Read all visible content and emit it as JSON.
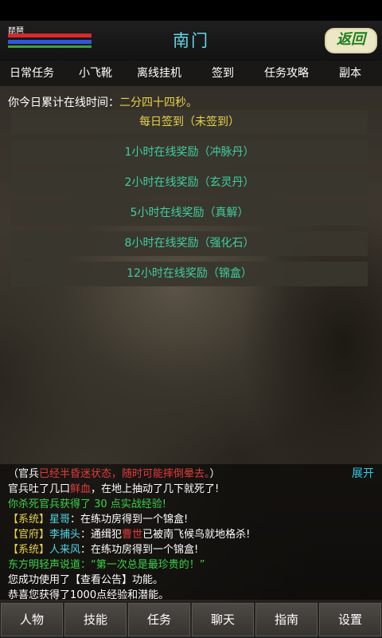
{
  "header": {
    "player_name": "琵琶",
    "title": "南门",
    "back_label": "返回"
  },
  "tabs": [
    "日常任务",
    "小飞靴",
    "离线挂机",
    "签到",
    "任务攻略",
    "副本"
  ],
  "online": {
    "label": "你今日累计在线时间：",
    "value": "二分四十四秒。"
  },
  "buttons": [
    "每日签到（未签到）",
    "1小时在线奖励（冲脉丹）",
    "2小时在线奖励（玄灵丹）",
    "5小时在线奖励（真解）",
    "8小时在线奖励（强化石）",
    "12小时在线奖励（锦盒）"
  ],
  "chat": {
    "expand_label": "展开",
    "line1": {
      "a": "（官兵",
      "b": "已经半昏迷状态，随时可能摔倒晕去。",
      "c": "）"
    },
    "line2": {
      "a": "官兵吐了几口",
      "b": "鲜血",
      "c": "，在地上抽动了几下就死了!"
    },
    "line3": "你杀死官兵获得了 30 点实战经验!",
    "line4": {
      "a": "【系统】",
      "b": "星哥",
      "c": "：在练功房得到一个锦盒!"
    },
    "line5": {
      "a": "【官府】",
      "b": "李捕头",
      "c": "：通缉犯",
      "d": "曹世",
      "e": "已被南飞候鸟就地格杀!"
    },
    "line6": {
      "a": "【系统】",
      "b": "人来风",
      "c": "：在练功房得到一个锦盒!"
    },
    "line7": "东方明轻声说道：“第一次总是最珍贵的！”",
    "line8": "您成功使用了【查看公告】功能。",
    "line9": "恭喜您获得了1000点经验和潜能。"
  },
  "bottom_nav": [
    "人物",
    "技能",
    "任务",
    "聊天",
    "指南",
    "设置"
  ]
}
